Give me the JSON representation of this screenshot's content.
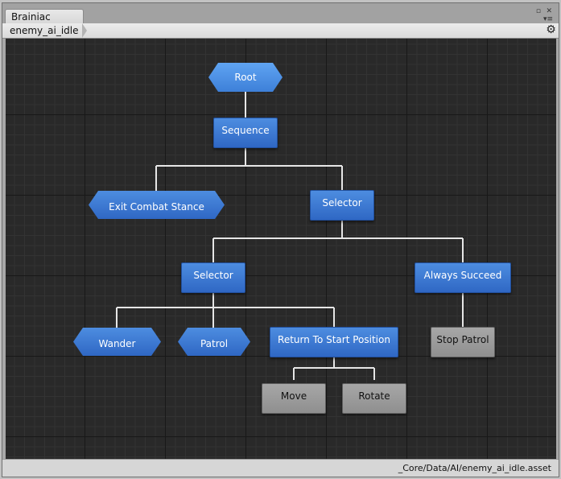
{
  "window": {
    "tab_title": "Brainiac"
  },
  "toolbar": {
    "breadcrumb": "enemy_ai_idle",
    "settings_icon": "gear-icon"
  },
  "graph": {
    "nodes": {
      "root": "Root",
      "sequence": "Sequence",
      "exit_combat_stance": "Exit Combat Stance",
      "selector_top": "Selector",
      "selector_inner": "Selector",
      "always_succeed": "Always Succeed",
      "wander": "Wander",
      "patrol": "Patrol",
      "return_to_start": "Return To Start Position",
      "stop_patrol": "Stop Patrol",
      "move": "Move",
      "rotate": "Rotate"
    },
    "colors": {
      "composite": "#3a78d4",
      "action": "#999999",
      "canvas": "#292929",
      "connection": "#e6e6e6"
    }
  },
  "status": {
    "asset_path": "_Core/Data/AI/enemy_ai_idle.asset"
  }
}
